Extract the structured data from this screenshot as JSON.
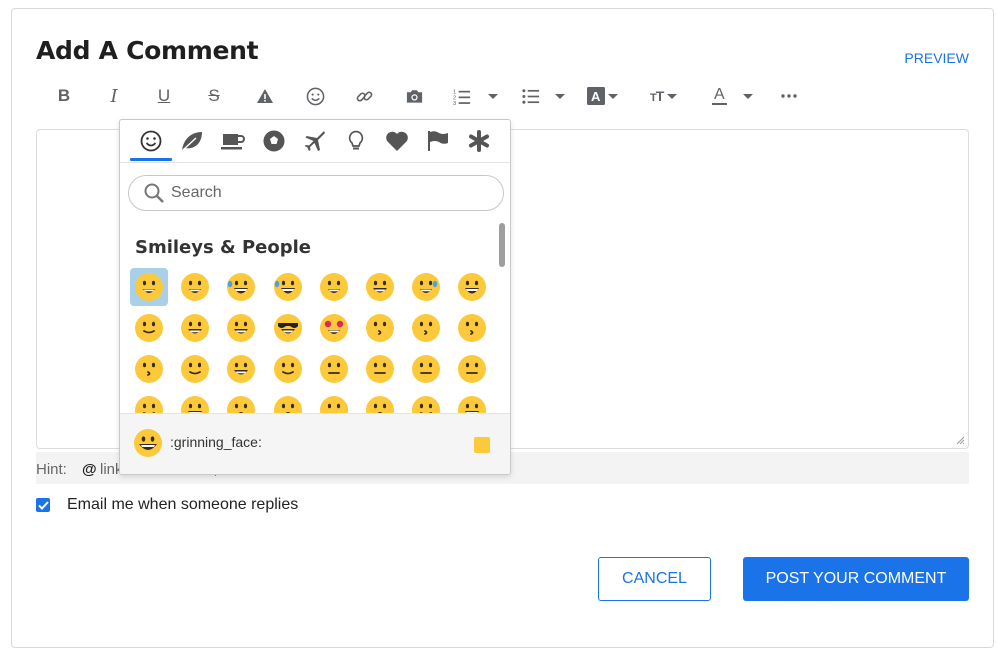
{
  "header": {
    "title": "Add A Comment",
    "preview_label": "PREVIEW"
  },
  "toolbar": {
    "buttons": [
      "bold-icon",
      "italic-icon",
      "underline-icon",
      "strikethrough-icon",
      "warning-icon",
      "emoji-icon",
      "link-icon",
      "camera-icon",
      "numbered-list-icon",
      "bulleted-list-icon",
      "text-background-icon",
      "text-size-icon",
      "text-color-icon",
      "more-icon"
    ]
  },
  "emoji_picker": {
    "categories": [
      "smiley-icon",
      "leaf-icon",
      "coffee-icon",
      "soccer-ball-icon",
      "airplane-icon",
      "lightbulb-icon",
      "heart-icon",
      "flag-icon",
      "symbols-icon"
    ],
    "search_placeholder": "Search",
    "section_title": "Smileys & People",
    "emojis": [
      "grin",
      "grinning-big",
      "joy",
      "rofl",
      "smiley",
      "smile",
      "sweat-smile",
      "laughing",
      "wink",
      "blush",
      "yum",
      "sunglasses",
      "heart-eyes",
      "kissing-heart",
      "kissing",
      "kissing-smiling",
      "kissing-closed",
      "slight-smile",
      "hugging",
      "thinking",
      "neutral",
      "expressionless",
      "no-mouth",
      "eye-roll",
      "smirk",
      "persevere",
      "disappointed-relieved",
      "open-mouth",
      "zipper",
      "hushed",
      "sleepy",
      "tired"
    ],
    "selected_index": 0,
    "footer_name": ":grinning_face:",
    "skin_tone_color": "#fcc93b"
  },
  "hint": {
    "label": "Hint:",
    "at": "@",
    "text": "links to members, content"
  },
  "email": {
    "label": "Email me when someone replies",
    "checked": true
  },
  "buttons": {
    "cancel": "CANCEL",
    "post": "POST YOUR COMMENT"
  },
  "colors": {
    "accent": "#1a73e8",
    "emoji_yellow": "#fcc93b"
  }
}
